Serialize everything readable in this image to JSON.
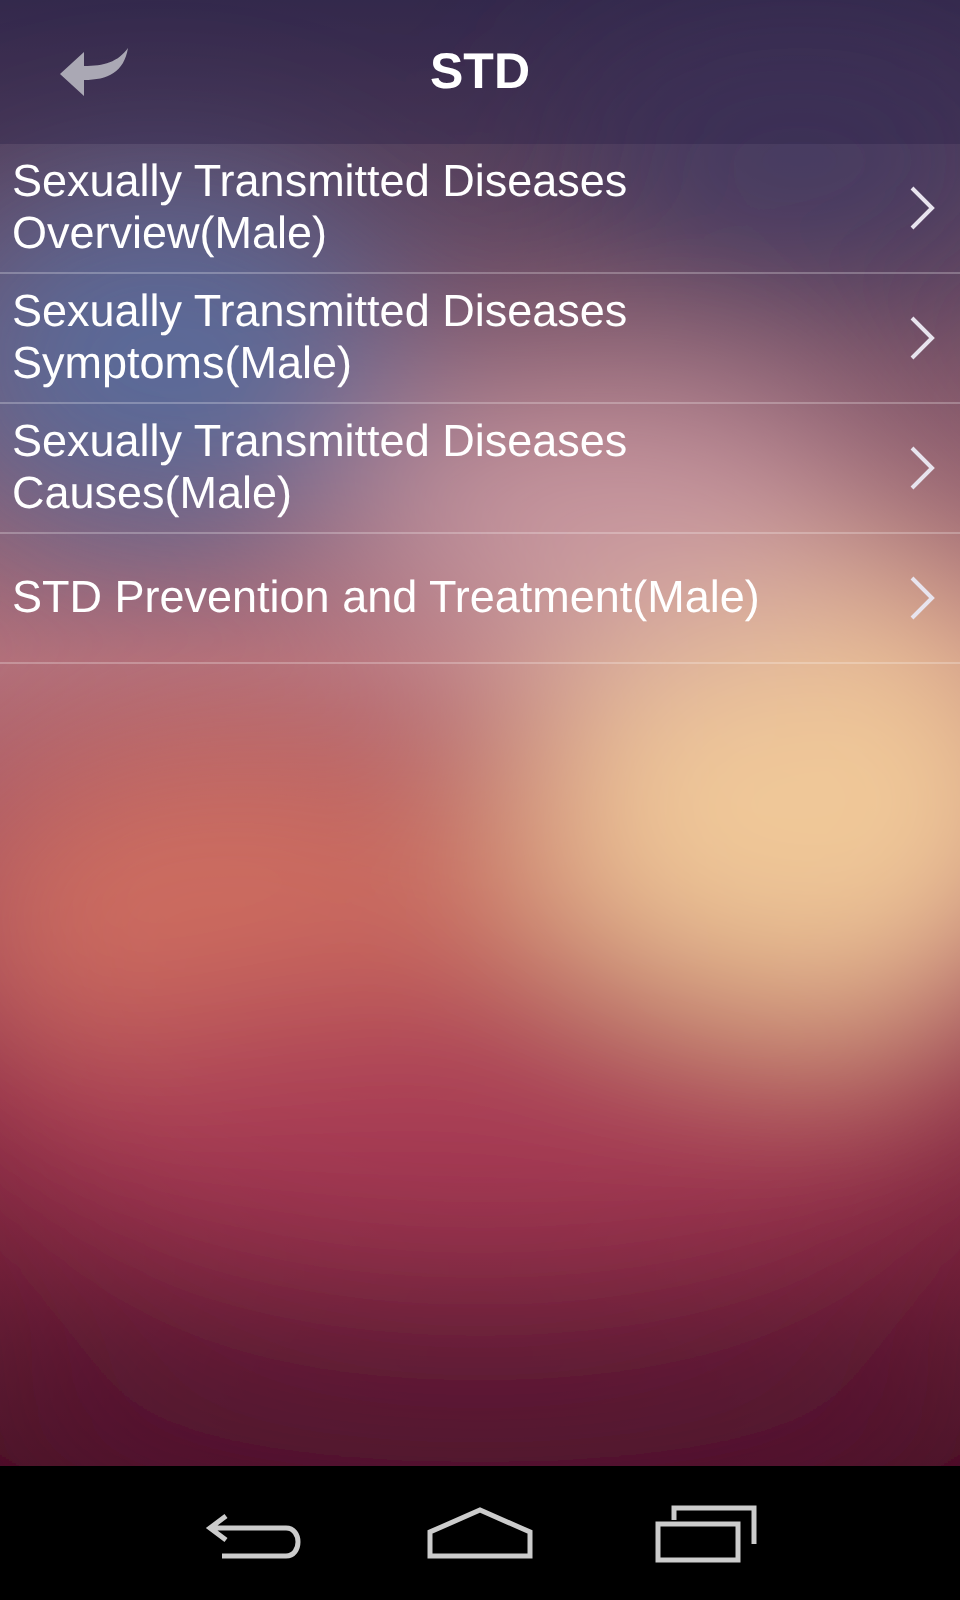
{
  "header": {
    "title": "STD"
  },
  "items": [
    {
      "label": "Sexually Transmitted Diseases Overview(Male)"
    },
    {
      "label": "Sexually Transmitted Diseases Symptoms(Male)"
    },
    {
      "label": "Sexually Transmitted Diseases Causes(Male)"
    },
    {
      "label": "STD Prevention and Treatment(Male)"
    }
  ]
}
